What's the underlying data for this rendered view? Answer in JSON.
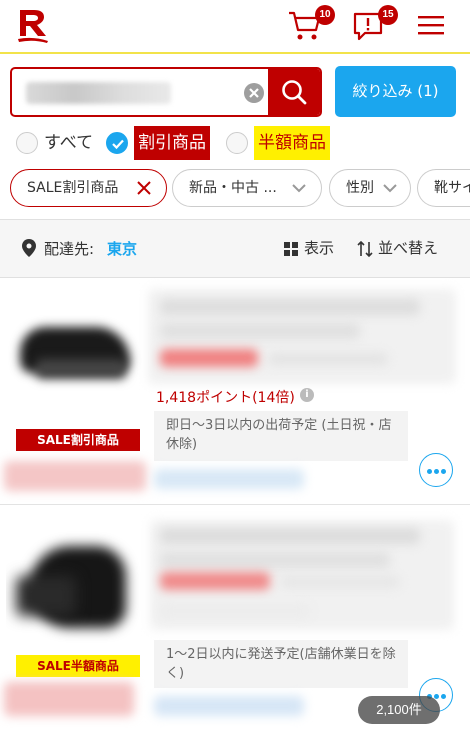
{
  "header": {
    "cart_badge": "10",
    "notice_badge": "15"
  },
  "search": {
    "filter_button_label": "絞り込み (1)"
  },
  "discount_options": [
    {
      "label": "すべて",
      "checked": false
    },
    {
      "label": "割引商品",
      "checked": true
    },
    {
      "label": "半額商品",
      "checked": false
    }
  ],
  "chips": [
    {
      "label": "SALE割引商品"
    },
    {
      "label": "新品・中古 ..."
    },
    {
      "label": "性別"
    },
    {
      "label": "靴サイ"
    }
  ],
  "delivery": {
    "label": "配達先:",
    "city": "東京",
    "view_label": "表示",
    "sort_label": "並べ替え"
  },
  "products": [
    {
      "sale_badge": "SALE割引商品",
      "points": "1,418ポイント(14倍)",
      "shipping": "即日〜3日以内の出荷予定 (土日祝・店休除)"
    },
    {
      "sale_badge": "SALE半額商品",
      "shipping": "1〜2日以内に発送予定(店舗休業日を除く)"
    }
  ],
  "result_count": "2,100件",
  "colors": {
    "brand_red": "#bf0000",
    "accent_blue": "#1ba6ee",
    "half_price_yellow": "#fff000"
  }
}
